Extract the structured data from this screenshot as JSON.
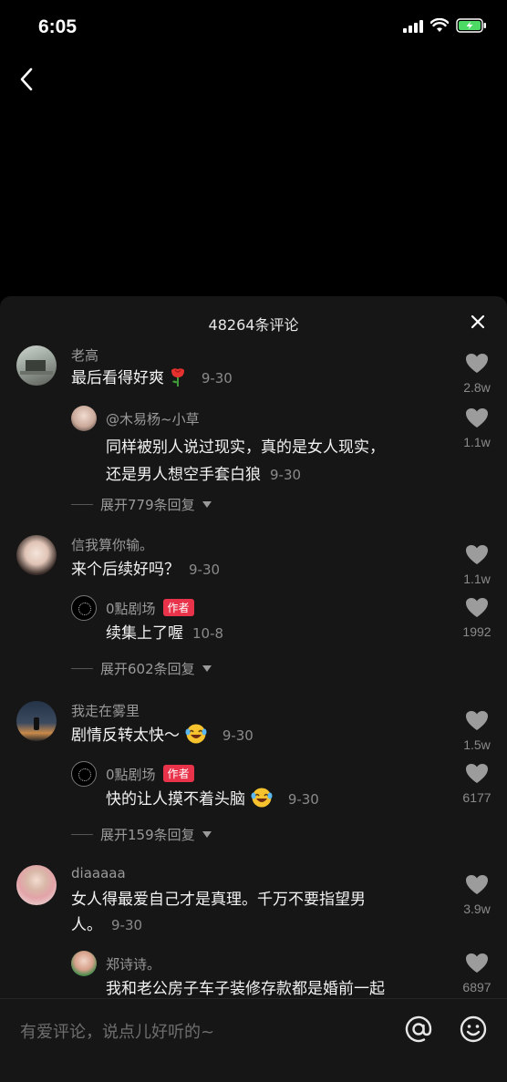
{
  "status": {
    "time": "6:05"
  },
  "sheet": {
    "title": "48264条评论"
  },
  "comments": [
    {
      "user": "老高",
      "text": "最后看得好爽",
      "date": "9-30",
      "likes": "2.8w",
      "reply": {
        "user": "@木易杨~小草",
        "line1": "同样被别人说过现实，真的是女人现实，",
        "line2": "还是男人想空手套白狼",
        "date": "9-30",
        "likes": "1.1w"
      },
      "expand": "展开779条回复"
    },
    {
      "user": "信我算你输。",
      "text": "来个后续好吗？",
      "date": "9-30",
      "likes": "1.1w",
      "reply": {
        "user": "0點剧场",
        "badge": "作者",
        "line1": "续集上了喔",
        "date": "10-8",
        "likes": "1992"
      },
      "expand": "展开602条回复"
    },
    {
      "user": "我走在雾里",
      "text": "剧情反转太快～",
      "date": "9-30",
      "likes": "1.5w",
      "reply": {
        "user": "0點剧场",
        "badge": "作者",
        "line1": "快的让人摸不着头脑",
        "date": "9-30",
        "likes": "6177"
      },
      "expand": "展开159条回复"
    },
    {
      "user": "diaaaaa",
      "line1": "女人得最爱自己才是真理。千万不要指望男",
      "line2": "人。",
      "date": "9-30",
      "likes": "3.9w",
      "reply": {
        "user": "郑诗诗。",
        "line1": "我和老公房子车子装修存款都是婚前一起",
        "likes": "6897"
      }
    }
  ],
  "input": {
    "placeholder": "有爱评论，说点儿好听的~"
  },
  "icons": {
    "heart": "heart-icon",
    "close": "close-icon",
    "back": "chevron-left-icon",
    "at": "at-icon",
    "emoji": "emoji-icon",
    "rose": "rose-emoji",
    "laugh": "laughing-emoji"
  },
  "colors": {
    "badge": "#e8334a",
    "battery": "#4cd964",
    "sheet_bg": "#161616"
  }
}
